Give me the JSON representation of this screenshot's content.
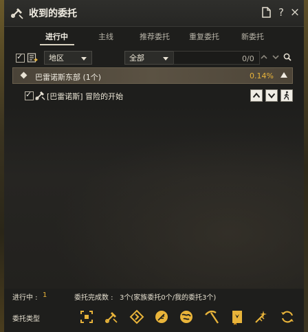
{
  "window": {
    "title": "收到的委托"
  },
  "titlebar": {
    "help_label": "?",
    "close_label": "×"
  },
  "tabs": [
    {
      "label": "进行中",
      "active": true
    },
    {
      "label": "主线",
      "active": false
    },
    {
      "label": "推荐委托",
      "active": false
    },
    {
      "label": "重复委托",
      "active": false
    },
    {
      "label": "新委托",
      "active": false
    }
  ],
  "filters": {
    "region": {
      "value": "地区"
    },
    "category": {
      "value": "全部"
    },
    "search": {
      "placeholder": ""
    },
    "count": "0/0"
  },
  "groups": [
    {
      "name": "巴雷诺斯东部 (1个)",
      "percent": "0.14%"
    }
  ],
  "quests": [
    {
      "title": "[巴雷诺斯] 冒险的开始",
      "checked": true
    }
  ],
  "footer": {
    "in_progress_label": "进行中 :",
    "in_progress_value": "1",
    "completed_label": "委托完成数 :",
    "completed_value": "3个(家族委托0个/我的委托3个)",
    "type_label": "委托类型",
    "type_icons": [
      "focus-icon",
      "sword-icon",
      "diamond-arrow-icon",
      "feather-icon",
      "globe-icon",
      "pickaxe-icon",
      "book-icon",
      "sparkle-icon",
      "refresh-icon"
    ]
  },
  "colors": {
    "accent": "#e9b43a",
    "group_bar": "#5b5243",
    "panel": "#1e1e1c"
  }
}
